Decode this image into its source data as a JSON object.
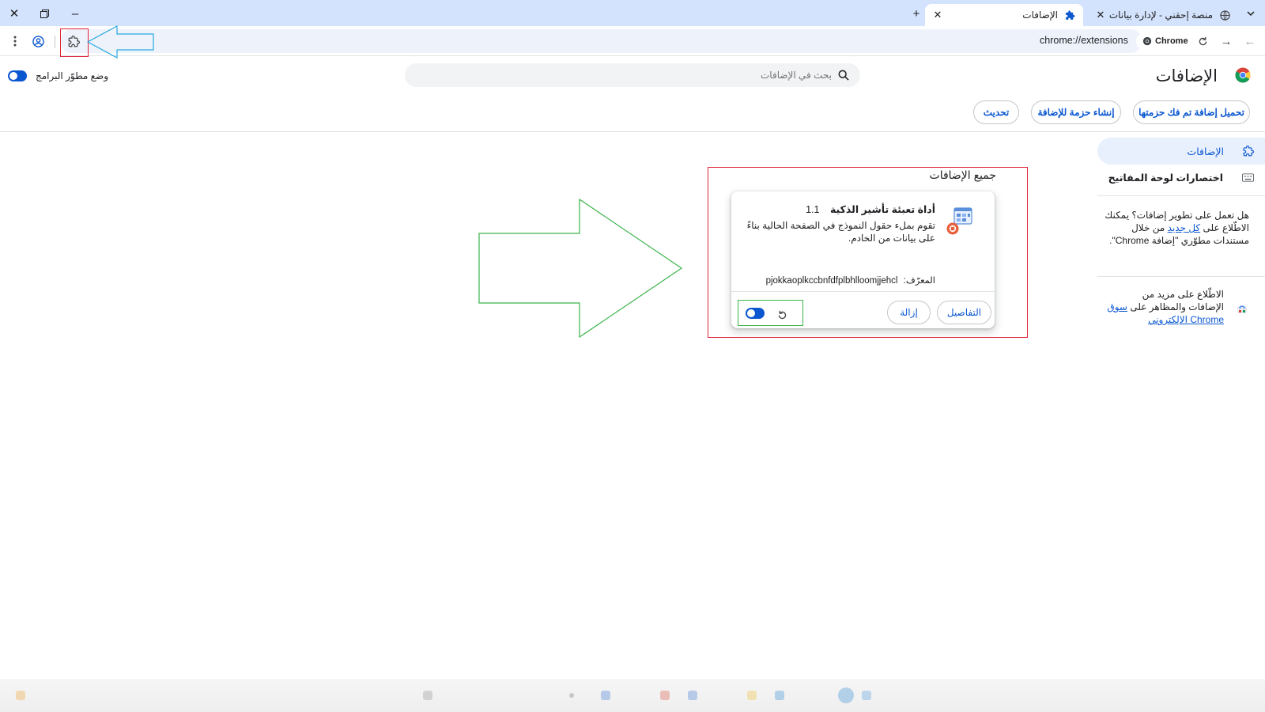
{
  "browser": {
    "tabs": [
      {
        "title": "منصة إحقني - لإدارة بيانات المتـ",
        "active": false
      },
      {
        "title": "الإضافات",
        "active": true
      }
    ],
    "new_tab_symbol": "+",
    "url": "chrome://extensions",
    "chip_label": "Chrome"
  },
  "header": {
    "title": "الإضافات",
    "search_placeholder": "بحث في الإضافات",
    "dev_mode_label": "وضع مطوّر البرامج",
    "dev_mode_on": true,
    "buttons": {
      "load_unpacked": "تحميل إضافة تم فك حزمتها",
      "pack": "إنشاء حزمة للإضافة",
      "update": "تحديث"
    }
  },
  "sidebar": {
    "items": [
      {
        "label": "الإضافات",
        "icon": "puzzle-icon",
        "active": true
      },
      {
        "label": "اختصارات لوحة المفاتيح",
        "icon": "keyboard-icon",
        "active": false
      }
    ],
    "dev_text_1": "هل تعمل على تطوير إضافات؟",
    "dev_text_2": "يمكنك الاطّلاع على",
    "dev_link": "كل جديد",
    "dev_text_3": "من خلال مستندات مطوّري \"إضافة Chrome\".",
    "store_text": "الاطّلاع على مزيد من الإضافات والمظاهر على",
    "store_link": "سوق Chrome الإلكتروني"
  },
  "main": {
    "section_title": "جميع الإضافات",
    "extension": {
      "name": "أداة تعبئة تأشير الذكية",
      "version": "1.1",
      "description": "تقوم بملء حقول النموذج في الصفحة الحالية بناءً على بيانات من الخادم.",
      "id_label": "المعرّف:",
      "id_value": "pjokkaoplkccbnfdfplbhlloomjjehcl",
      "details_button": "التفاصيل",
      "remove_button": "إزالة",
      "enabled": true
    }
  },
  "colors": {
    "accent": "#0b57d0",
    "tabstrip": "#d3e3fd",
    "annotation_red": "#e0243a",
    "annotation_green": "#3cb44b",
    "annotation_blue": "#29a8e0"
  }
}
